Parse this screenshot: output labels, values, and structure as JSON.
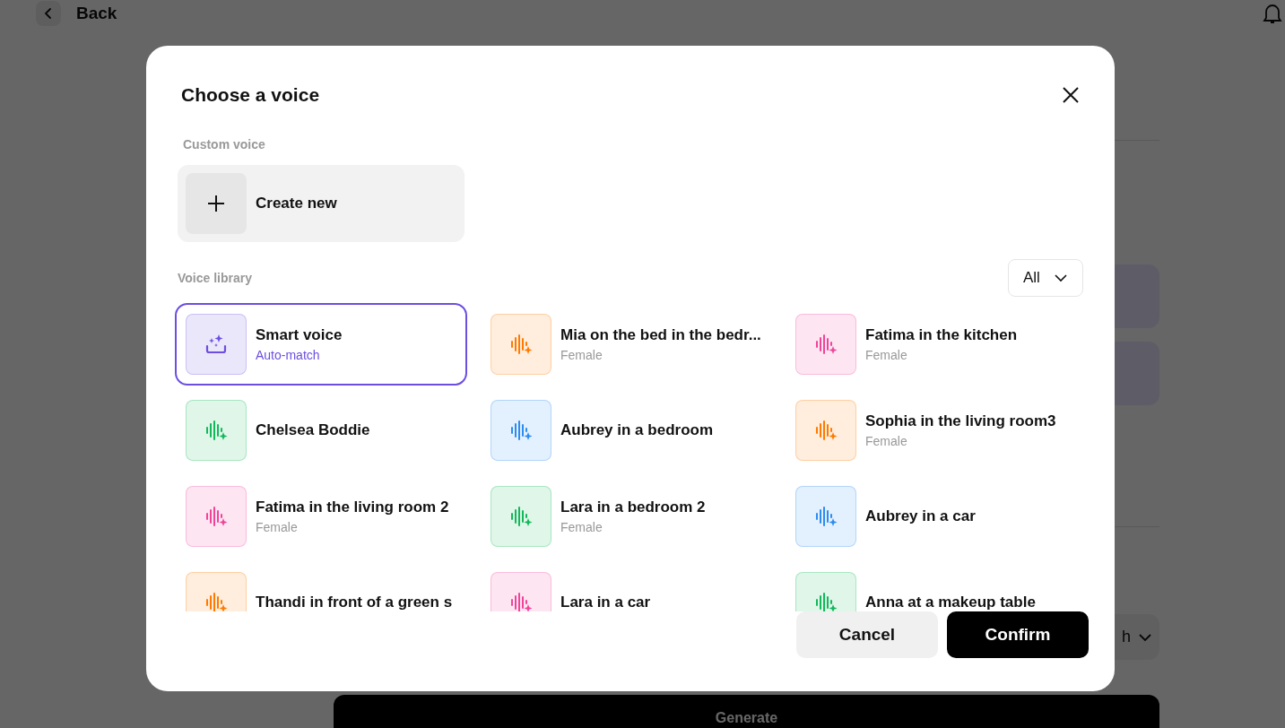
{
  "page": {
    "back_label": "Back",
    "dropdown_value": "h",
    "generate_label": "Generate"
  },
  "dialog": {
    "title": "Choose a voice",
    "custom_section": {
      "label": "Custom voice",
      "create_label": "Create new"
    },
    "library": {
      "label": "Voice library",
      "filter": "All",
      "voices": [
        {
          "kind": "smart",
          "name": "Smart voice",
          "subtitle": "Auto-match",
          "color": "#6c4ee0",
          "selected": true
        },
        {
          "kind": "voice",
          "name": "Mia on the bed in the bedr...",
          "subtitle": "Female",
          "color": "#ff7a00",
          "selected": false
        },
        {
          "kind": "voice",
          "name": "Fatima in the kitchen",
          "subtitle": "Female",
          "color": "#f0449a",
          "selected": false
        },
        {
          "kind": "voice",
          "name": "Chelsea Boddie",
          "color": "#12b85a",
          "selected": false
        },
        {
          "kind": "voice",
          "name": "Aubrey in a bedroom",
          "color": "#2d8cf0",
          "selected": false
        },
        {
          "kind": "voice",
          "name": "Sophia in the living room3",
          "subtitle": "Female",
          "color": "#ff7a00",
          "selected": false
        },
        {
          "kind": "voice",
          "name": "Fatima in the living room 2",
          "subtitle": "Female",
          "color": "#f0449a",
          "selected": false
        },
        {
          "kind": "voice",
          "name": "Lara in a bedroom 2",
          "subtitle": "Female",
          "color": "#12b85a",
          "selected": false
        },
        {
          "kind": "voice",
          "name": "Aubrey in a car",
          "color": "#2d8cf0",
          "selected": false
        },
        {
          "kind": "voice",
          "name": "Thandi in front of a green s",
          "color": "#ff7a00",
          "selected": false
        },
        {
          "kind": "voice",
          "name": "Lara in a car",
          "color": "#f0449a",
          "selected": false
        },
        {
          "kind": "voice",
          "name": "Anna at a makeup table",
          "color": "#12b85a",
          "selected": false
        }
      ]
    },
    "buttons": {
      "cancel": "Cancel",
      "confirm": "Confirm"
    }
  }
}
